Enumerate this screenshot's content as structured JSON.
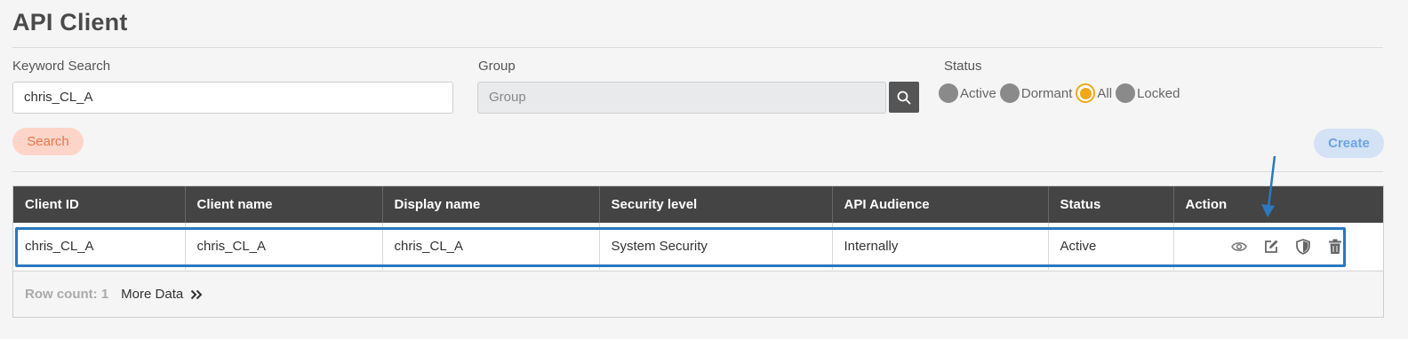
{
  "page": {
    "title": "API Client"
  },
  "filters": {
    "keyword_label": "Keyword Search",
    "keyword_value": "chris_CL_A",
    "group_label": "Group",
    "group_placeholder": "Group",
    "status_label": "Status",
    "status_options": [
      "Active",
      "Dormant",
      "All",
      "Locked"
    ],
    "status_selected": "All"
  },
  "buttons": {
    "search": "Search",
    "create": "Create"
  },
  "table": {
    "columns": [
      "Client ID",
      "Client name",
      "Display name",
      "Security level",
      "API Audience",
      "Status",
      "Action"
    ],
    "rows": [
      {
        "client_id": "chris_CL_A",
        "client_name": "chris_CL_A",
        "display_name": "chris_CL_A",
        "security_level": "System Security",
        "api_audience": "Internally",
        "status": "Active"
      }
    ],
    "action_icons": [
      "eye-icon",
      "edit-icon",
      "shield-icon",
      "trash-icon"
    ]
  },
  "footer": {
    "row_count": "Row count: 1",
    "more_data": "More Data"
  },
  "colors": {
    "header_bg": "#444444",
    "highlight": "#2a78c0",
    "radio_selected": "#f0a818",
    "search_btn": "#fcd5c8",
    "create_btn": "#d3e2f5"
  }
}
